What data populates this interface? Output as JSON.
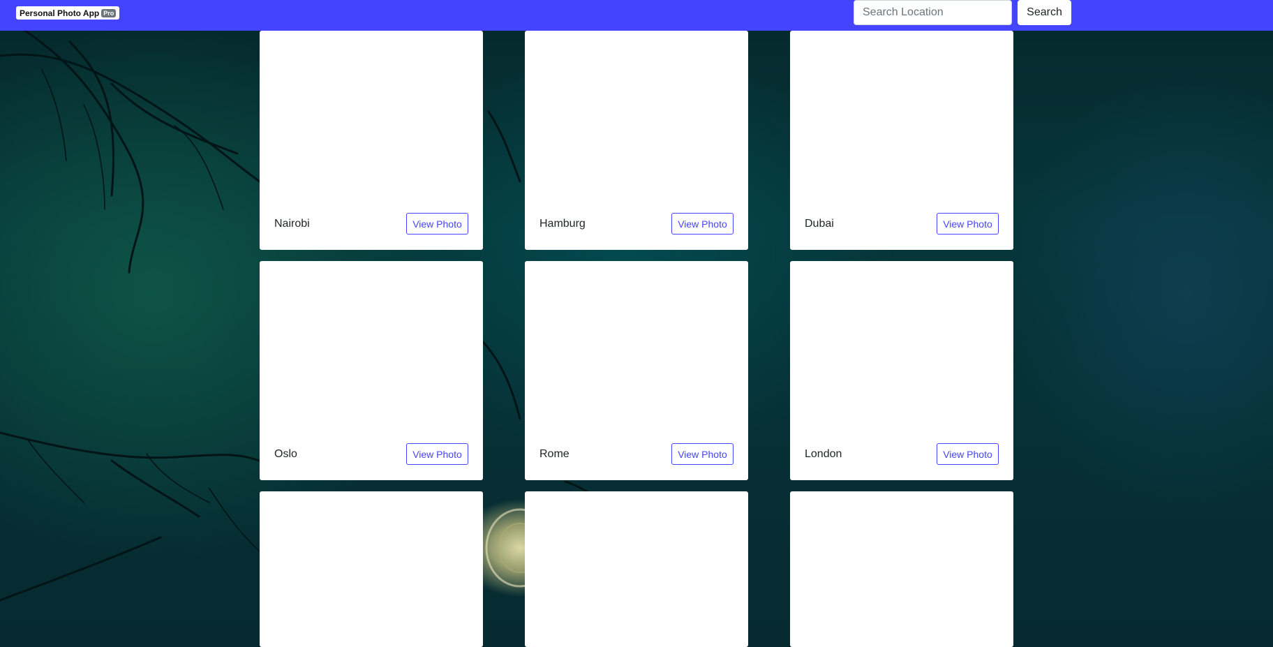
{
  "navbar": {
    "brand": "Personal Photo App",
    "badge": "Pro",
    "search_placeholder": "Search Location",
    "search_label": "Search",
    "color": "#4444ff"
  },
  "cards": [
    {
      "location": "Nairobi",
      "button": "View Photo"
    },
    {
      "location": "Hamburg",
      "button": "View Photo"
    },
    {
      "location": "Dubai",
      "button": "View Photo"
    },
    {
      "location": "Oslo",
      "button": "View Photo"
    },
    {
      "location": "Rome",
      "button": "View Photo"
    },
    {
      "location": "London",
      "button": "View Photo"
    },
    {
      "location": "",
      "button": ""
    },
    {
      "location": "",
      "button": ""
    },
    {
      "location": "",
      "button": ""
    }
  ]
}
